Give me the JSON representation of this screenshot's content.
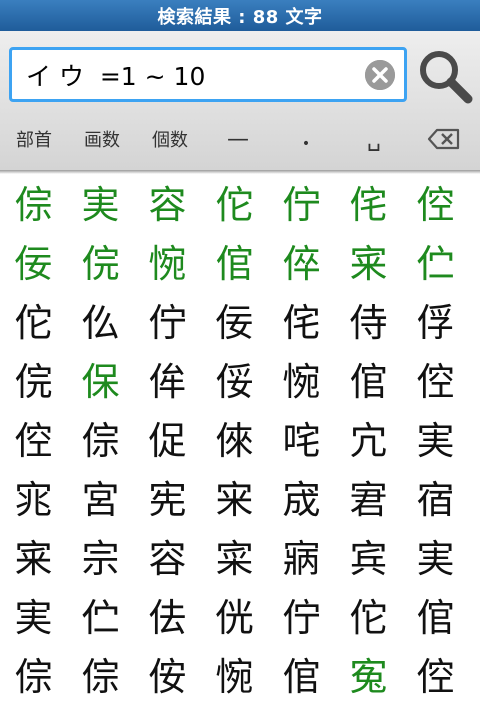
{
  "title": "検索結果 : 88 文字",
  "search": {
    "value": "イ ウ  =1 ~ 10"
  },
  "toolbar": {
    "busyu_label": "部首",
    "kakusu_label": "画数",
    "kosu_label": "個数",
    "dash_label": "—",
    "dot_label": "•",
    "space_label": "␣"
  },
  "colors": {
    "highlight": "#1e8a1e",
    "accent": "#3da3f2",
    "title_bar": "#2a6db0"
  },
  "grid": [
    [
      {
        "c": "倧",
        "g": true
      },
      {
        "c": "実",
        "g": true
      },
      {
        "c": "容",
        "g": true
      },
      {
        "c": "佗",
        "g": true
      },
      {
        "c": "佇",
        "g": true
      },
      {
        "c": "侘",
        "g": true
      },
      {
        "c": "倥",
        "g": true
      }
    ],
    [
      {
        "c": "佞",
        "g": true
      },
      {
        "c": "俒",
        "g": true
      },
      {
        "c": "惋",
        "g": true
      },
      {
        "c": "倌",
        "g": true
      },
      {
        "c": "倅",
        "g": true
      },
      {
        "c": "宷",
        "g": true
      },
      {
        "c": "伫",
        "g": true
      }
    ],
    [
      {
        "c": "佗",
        "g": false
      },
      {
        "c": "仫",
        "g": false
      },
      {
        "c": "佇",
        "g": false
      },
      {
        "c": "佞",
        "g": false
      },
      {
        "c": "侘",
        "g": false
      },
      {
        "c": "侍",
        "g": false
      },
      {
        "c": "俘",
        "g": false
      }
    ],
    [
      {
        "c": "俒",
        "g": false
      },
      {
        "c": "保",
        "g": true
      },
      {
        "c": "侔",
        "g": false
      },
      {
        "c": "俀",
        "g": false
      },
      {
        "c": "惋",
        "g": false
      },
      {
        "c": "倌",
        "g": false
      },
      {
        "c": "倥",
        "g": false
      }
    ],
    [
      {
        "c": "倥",
        "g": false
      },
      {
        "c": "倧",
        "g": false
      },
      {
        "c": "促",
        "g": false
      },
      {
        "c": "倈",
        "g": false
      },
      {
        "c": "咤",
        "g": false
      },
      {
        "c": "宂",
        "g": false
      },
      {
        "c": "実",
        "g": false
      }
    ],
    [
      {
        "c": "宨",
        "g": false
      },
      {
        "c": "宮",
        "g": false
      },
      {
        "c": "宪",
        "g": false
      },
      {
        "c": "宩",
        "g": false
      },
      {
        "c": "宬",
        "g": false
      },
      {
        "c": "宭",
        "g": false
      },
      {
        "c": "宿",
        "g": false
      }
    ],
    [
      {
        "c": "宷",
        "g": false
      },
      {
        "c": "宗",
        "g": false
      },
      {
        "c": "容",
        "g": false
      },
      {
        "c": "寀",
        "g": false
      },
      {
        "c": "寎",
        "g": false
      },
      {
        "c": "宾",
        "g": false
      },
      {
        "c": "実",
        "g": false
      }
    ],
    [
      {
        "c": "実",
        "g": false
      },
      {
        "c": "伫",
        "g": false
      },
      {
        "c": "佉",
        "g": false
      },
      {
        "c": "侊",
        "g": false
      },
      {
        "c": "佇",
        "g": false
      },
      {
        "c": "佗",
        "g": false
      },
      {
        "c": "倌",
        "g": false
      }
    ],
    [
      {
        "c": "倧",
        "g": false
      },
      {
        "c": "倧",
        "g": false
      },
      {
        "c": "侒",
        "g": false
      },
      {
        "c": "惋",
        "g": false
      },
      {
        "c": "倌",
        "g": false
      },
      {
        "c": "寃",
        "g": true
      },
      {
        "c": "倥",
        "g": false
      }
    ]
  ]
}
